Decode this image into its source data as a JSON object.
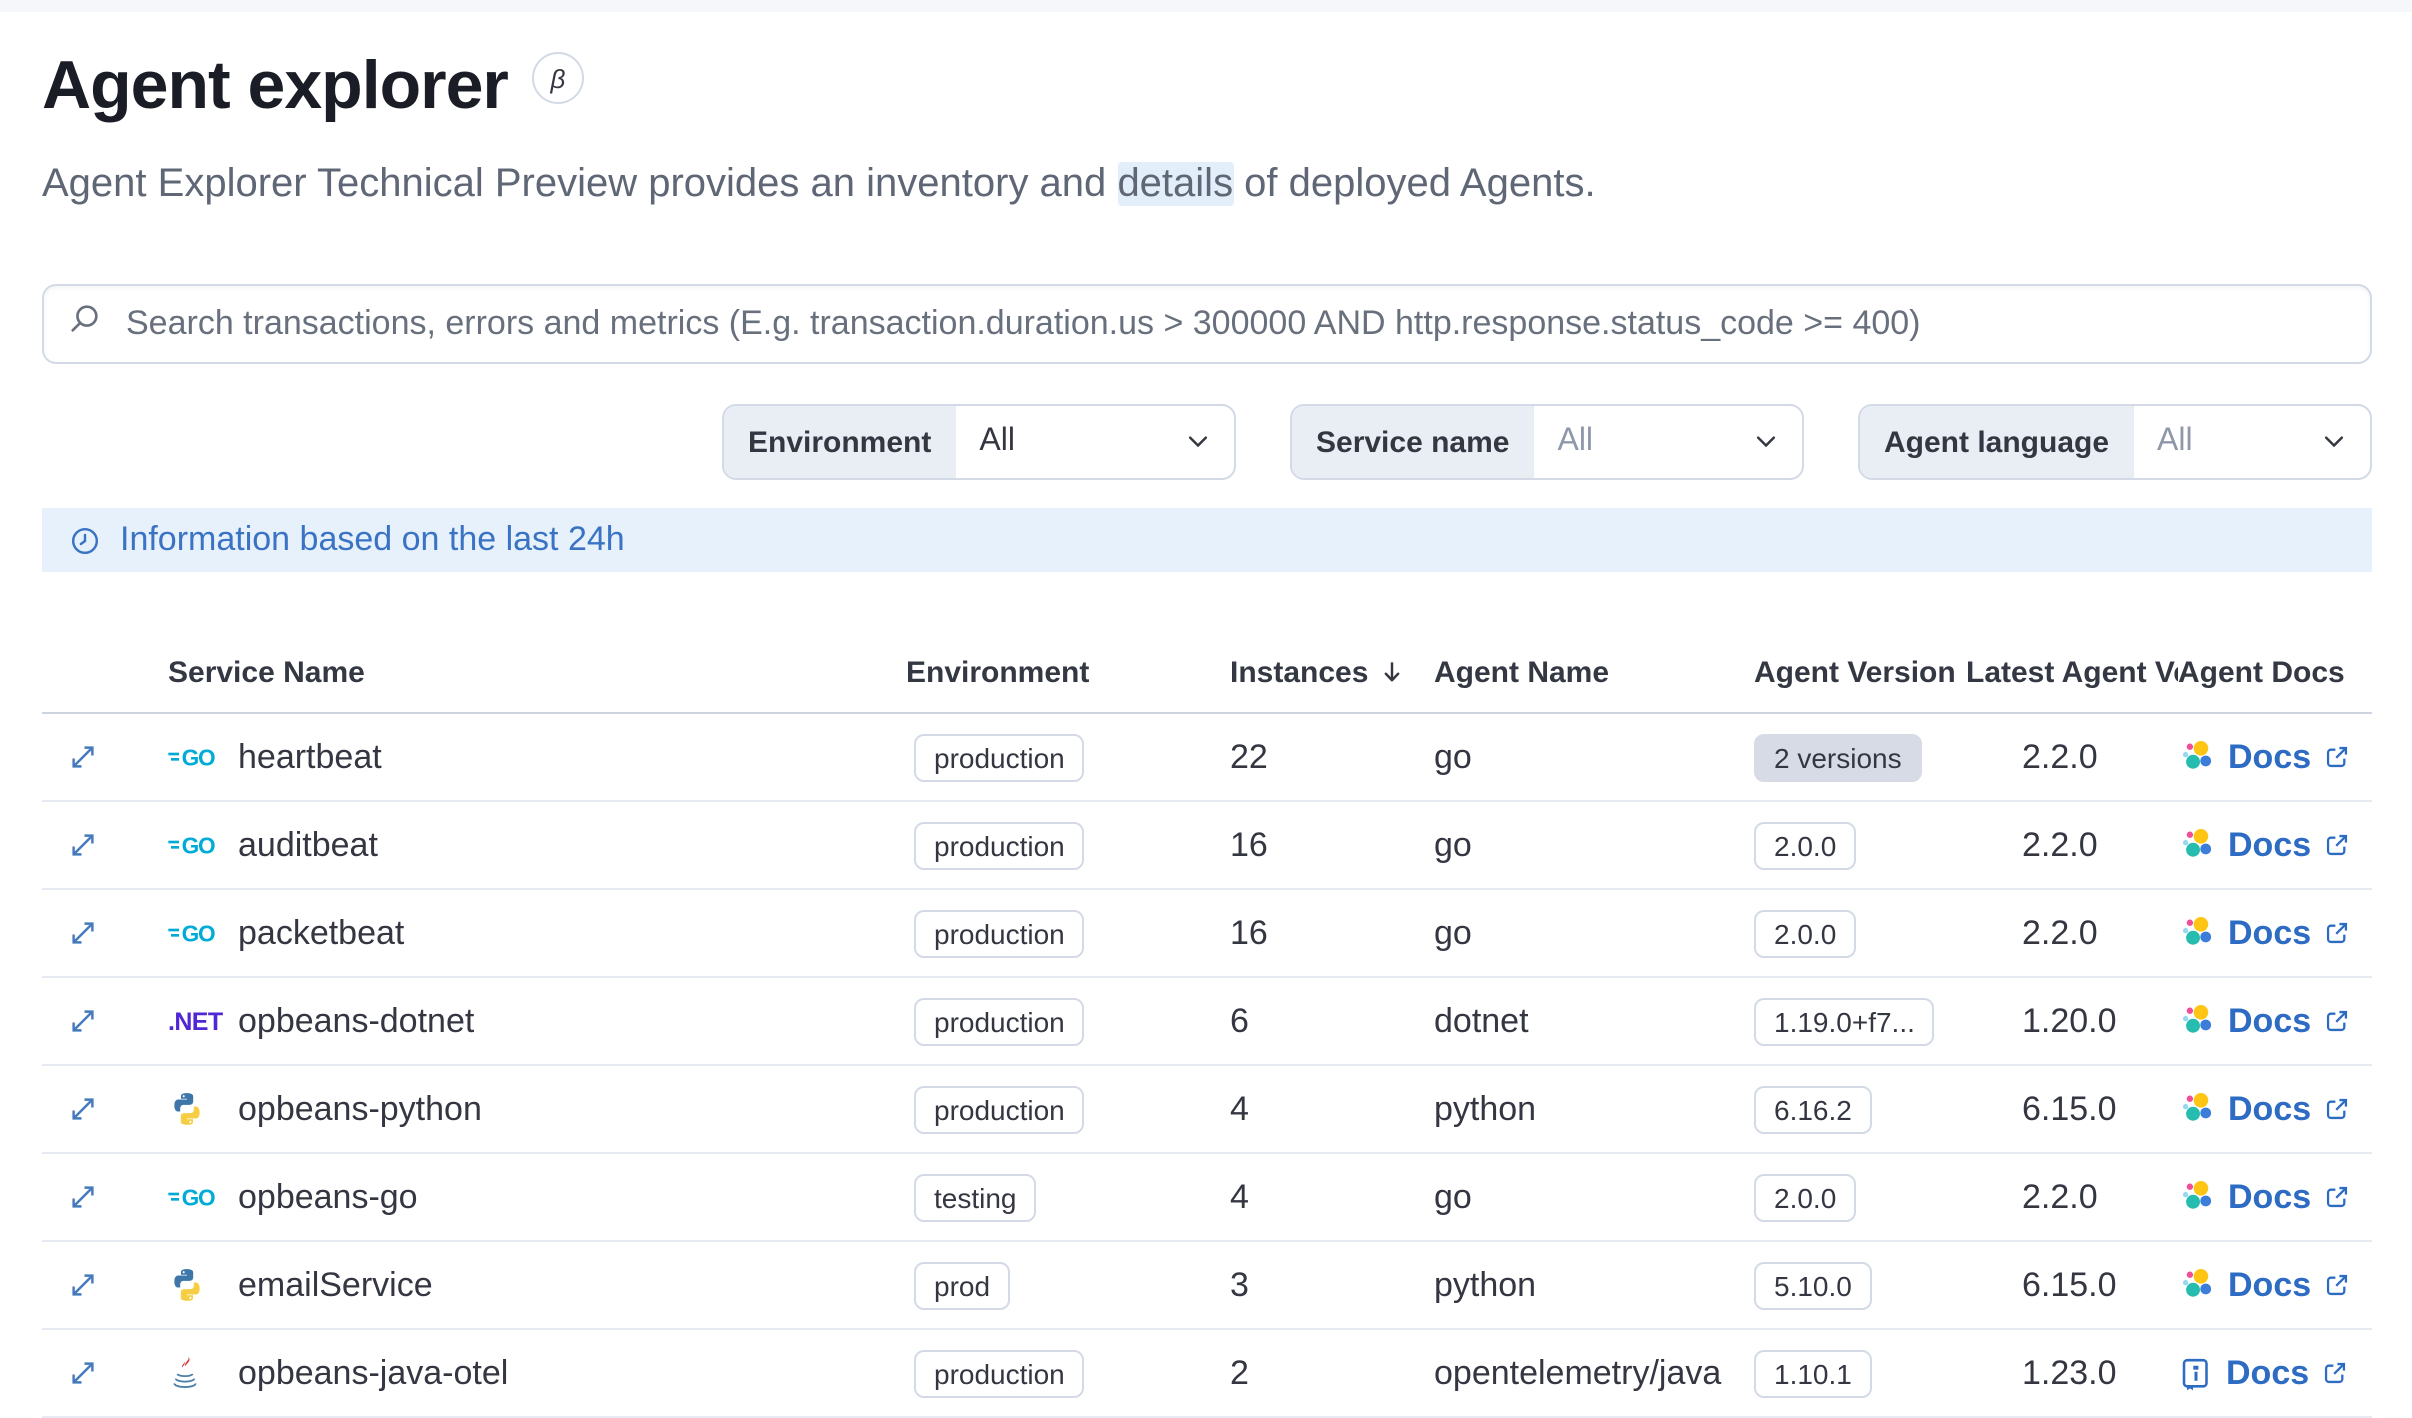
{
  "header": {
    "title": "Agent explorer",
    "beta_symbol": "β",
    "description": {
      "before": "Agent Explorer Technical Preview provides an inventory and ",
      "highlight": "details",
      "after": " of deployed Agents."
    }
  },
  "search": {
    "placeholder": "Search transactions, errors and metrics (E.g. transaction.duration.us > 300000 AND http.response.status_code >= 400)"
  },
  "filters": [
    {
      "label": "Environment",
      "value": "All",
      "value_muted": false
    },
    {
      "label": "Service name",
      "value": "All",
      "value_muted": true
    },
    {
      "label": "Agent language",
      "value": "All",
      "value_muted": true
    }
  ],
  "banner": {
    "text": "Information based on the last 24h"
  },
  "table": {
    "columns": [
      "Service Name",
      "Environment",
      "Instances",
      "Agent Name",
      "Agent Version",
      "Latest Agent Ve",
      "Agent Docs"
    ],
    "sort": {
      "column": "Instances",
      "direction": "desc"
    },
    "rows": [
      {
        "service": "heartbeat",
        "icon": "go",
        "environment": "production",
        "instances": "22",
        "agent": "go",
        "version_badge": {
          "text": "2 versions",
          "variant": "filled"
        },
        "latest_version": "2.2.0",
        "docs_label": "Docs",
        "docs_icon": "elastic"
      },
      {
        "service": "auditbeat",
        "icon": "go",
        "environment": "production",
        "instances": "16",
        "agent": "go",
        "version_badge": {
          "text": "2.0.0",
          "variant": "hollow"
        },
        "latest_version": "2.2.0",
        "docs_label": "Docs",
        "docs_icon": "elastic"
      },
      {
        "service": "packetbeat",
        "icon": "go",
        "environment": "production",
        "instances": "16",
        "agent": "go",
        "version_badge": {
          "text": "2.0.0",
          "variant": "hollow"
        },
        "latest_version": "2.2.0",
        "docs_label": "Docs",
        "docs_icon": "elastic"
      },
      {
        "service": "opbeans-dotnet",
        "icon": "dotnet",
        "environment": "production",
        "instances": "6",
        "agent": "dotnet",
        "version_badge": {
          "text": "1.19.0+f7...",
          "variant": "hollow"
        },
        "latest_version": "1.20.0",
        "docs_label": "Docs",
        "docs_icon": "elastic"
      },
      {
        "service": "opbeans-python",
        "icon": "python",
        "environment": "production",
        "instances": "4",
        "agent": "python",
        "version_badge": {
          "text": "6.16.2",
          "variant": "hollow"
        },
        "latest_version": "6.15.0",
        "docs_label": "Docs",
        "docs_icon": "elastic"
      },
      {
        "service": "opbeans-go",
        "icon": "go",
        "environment": "testing",
        "instances": "4",
        "agent": "go",
        "version_badge": {
          "text": "2.0.0",
          "variant": "hollow"
        },
        "latest_version": "2.2.0",
        "docs_label": "Docs",
        "docs_icon": "elastic"
      },
      {
        "service": "emailService",
        "icon": "python",
        "environment": "prod",
        "instances": "3",
        "agent": "python",
        "version_badge": {
          "text": "5.10.0",
          "variant": "hollow"
        },
        "latest_version": "6.15.0",
        "docs_label": "Docs",
        "docs_icon": "elastic"
      },
      {
        "service": "opbeans-java-otel",
        "icon": "java",
        "environment": "production",
        "instances": "2",
        "agent": "opentelemetry/java",
        "version_badge": {
          "text": "1.10.1",
          "variant": "hollow"
        },
        "latest_version": "1.23.0",
        "docs_label": "Docs",
        "docs_icon": "book"
      }
    ]
  }
}
